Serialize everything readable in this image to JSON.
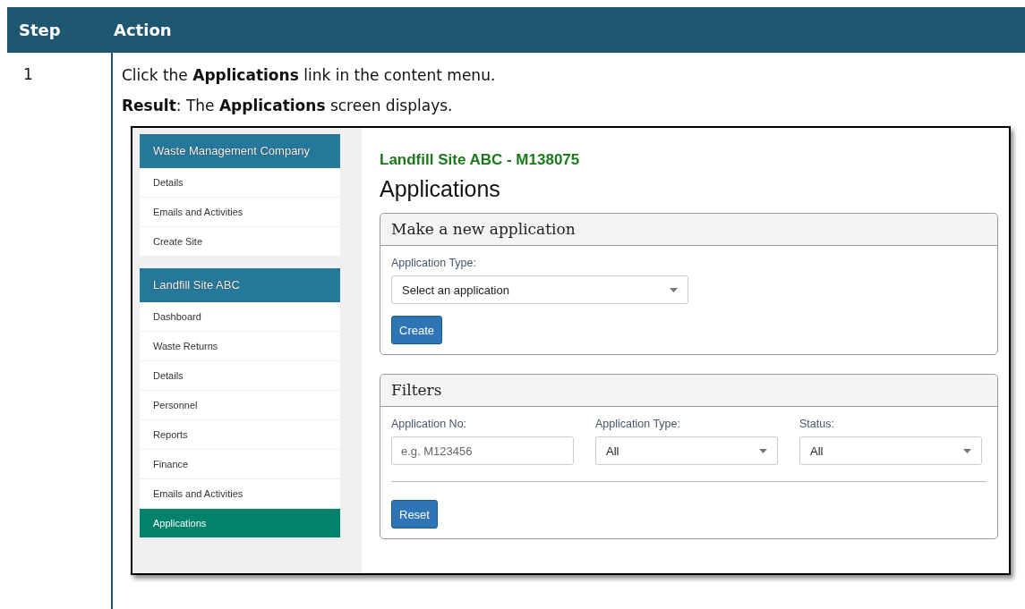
{
  "table": {
    "columns": [
      "Step",
      "Action"
    ],
    "rows": [
      {
        "step": "1",
        "instruction": "Click the **Applications** link in the content menu.",
        "result": "**Result**: The **Applications** screen displays.",
        "screenshot": {
          "sidebar": {
            "groups": [
              {
                "title": "Waste Management Company",
                "items": [
                  {
                    "label": "Details",
                    "selected": false
                  },
                  {
                    "label": "Emails and Activities",
                    "selected": false
                  },
                  {
                    "label": "Create Site",
                    "selected": false
                  }
                ]
              },
              {
                "title": "Landfill Site ABC",
                "items": [
                  {
                    "label": "Dashboard",
                    "selected": false
                  },
                  {
                    "label": "Waste Returns",
                    "selected": false
                  },
                  {
                    "label": "Details",
                    "selected": false
                  },
                  {
                    "label": "Personnel",
                    "selected": false
                  },
                  {
                    "label": "Reports",
                    "selected": false
                  },
                  {
                    "label": "Finance",
                    "selected": false
                  },
                  {
                    "label": "Emails and Activities",
                    "selected": false
                  },
                  {
                    "label": "Applications",
                    "selected": true
                  }
                ]
              }
            ]
          },
          "main": {
            "site_title": "Landfill Site ABC - M138075",
            "page_title": "Applications",
            "new_application": {
              "title": "Make a new application",
              "field_label": "Application Type:",
              "select_value": "Select an application",
              "button": "Create"
            },
            "filters": {
              "title": "Filters",
              "fields": [
                {
                  "kind": "text",
                  "label": "Application No:",
                  "placeholder": "e.g. M123456"
                },
                {
                  "kind": "select",
                  "label": "Application Type:",
                  "value": "All"
                },
                {
                  "kind": "select",
                  "label": "Status:",
                  "value": "All"
                }
              ],
              "button": "Reset"
            }
          }
        }
      }
    ]
  }
}
